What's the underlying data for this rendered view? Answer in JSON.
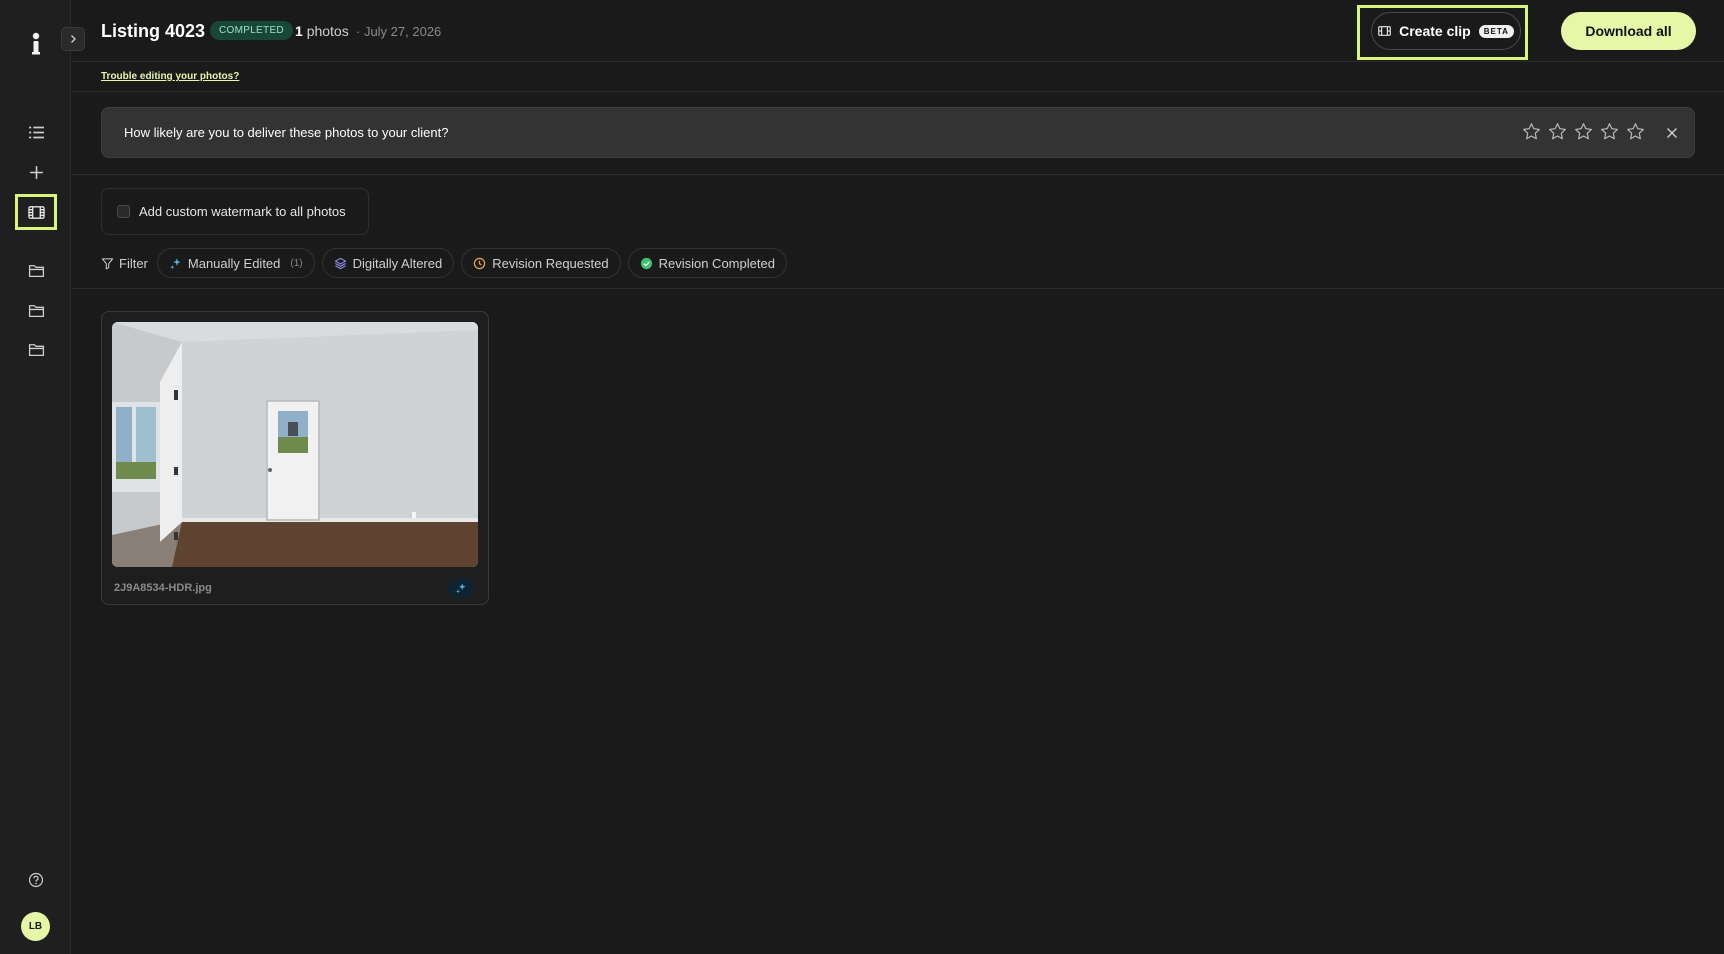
{
  "header": {
    "title": "Listing 4023",
    "status": "COMPLETED",
    "photo_count": "1",
    "photo_count_label": "photos",
    "date": "· July 27, 2026",
    "create_clip_label": "Create clip",
    "beta_label": "BETA",
    "download_all_label": "Download all"
  },
  "trouble_link": "Trouble editing your photos?",
  "survey": {
    "question": "How likely are you to deliver these photos to your client?",
    "star_count": 5
  },
  "watermark": {
    "label": "Add custom watermark to all photos",
    "checked": false
  },
  "filters": {
    "label": "Filter",
    "chips": [
      {
        "label": "Manually Edited",
        "count": "(1)",
        "icon": "sparkle-icon",
        "color": "#4fb8e8"
      },
      {
        "label": "Digitally Altered",
        "icon": "layers-icon",
        "color": "#8f8cf2"
      },
      {
        "label": "Revision Requested",
        "icon": "clock-icon",
        "color": "#e8a93a"
      },
      {
        "label": "Revision Completed",
        "icon": "check-circle-icon",
        "color": "#3fc26f"
      }
    ]
  },
  "photos": [
    {
      "filename": "2J9A8534-HDR.jpg",
      "badge_icon": "sparkle-icon"
    }
  ],
  "user": {
    "initials": "LB"
  },
  "colors": {
    "accent": "#e6f7a8",
    "highlight": "#d8f57e",
    "background": "#1a1a1a"
  }
}
